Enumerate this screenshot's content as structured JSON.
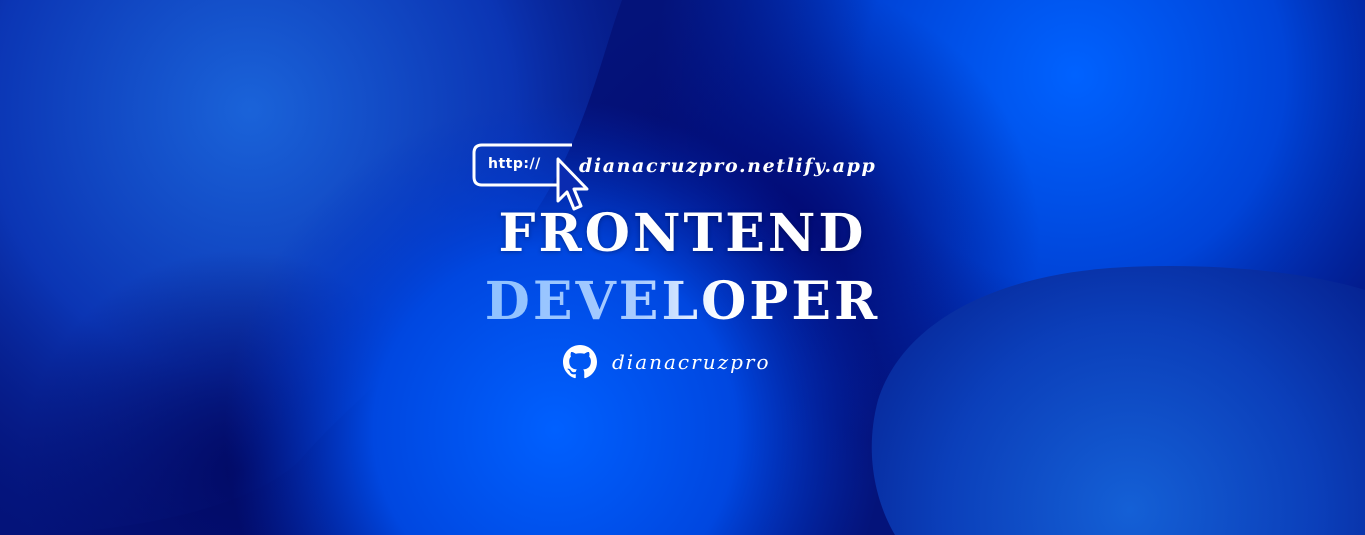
{
  "banner": {
    "url_prefix": "http://",
    "url": "dianacruzpro.netlify.app",
    "title_line1": "FRONTEND",
    "title_line2": "DEVELOPER",
    "github_username": "dianacruzpro",
    "icons": {
      "url_box": "browser-address-box-icon",
      "cursor": "mouse-pointer-icon",
      "github": "github-octocat-icon"
    },
    "colors": {
      "background_dark": "#020a5e",
      "background_bright": "#0a5cff",
      "text": "#ffffff",
      "highlight": "#9cc6ff"
    }
  }
}
